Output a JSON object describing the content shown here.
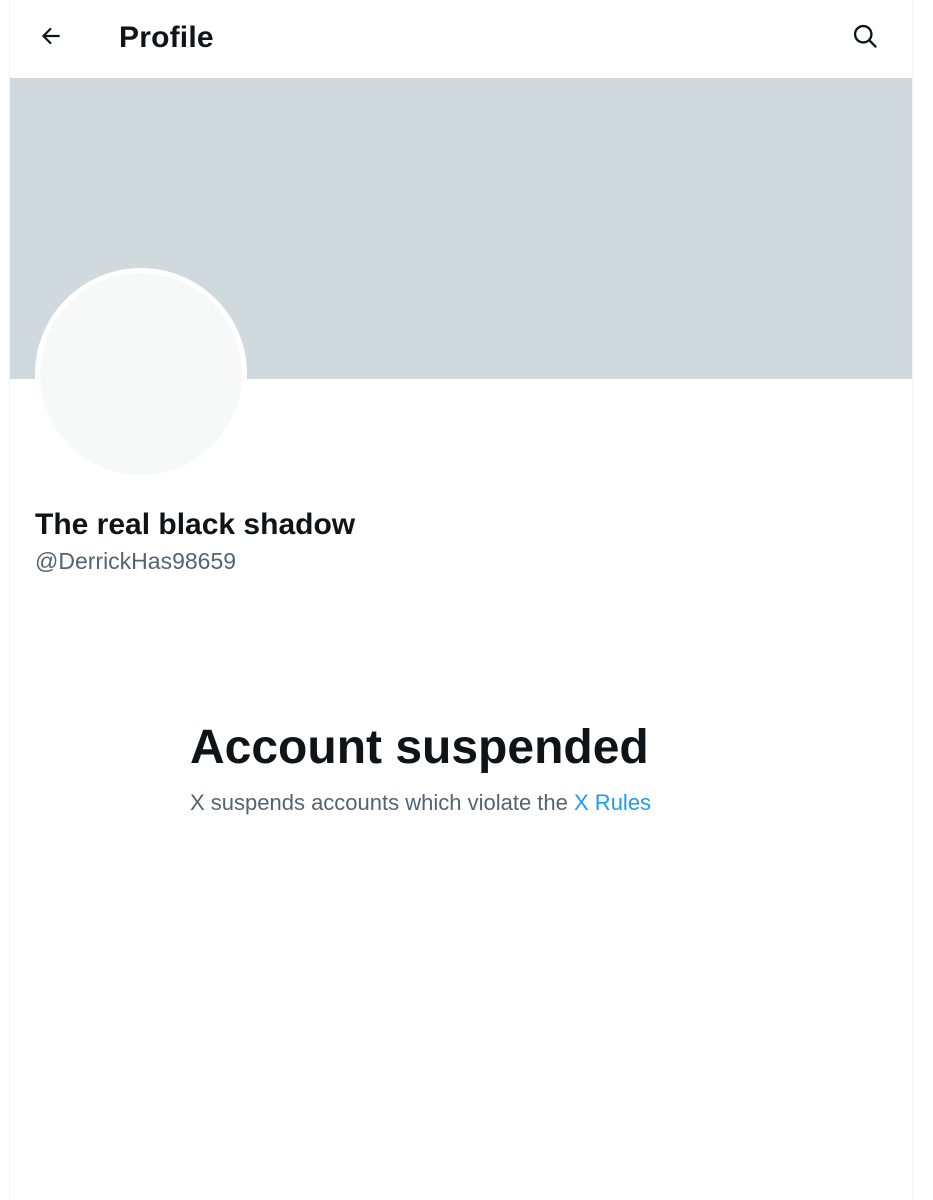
{
  "header": {
    "title": "Profile",
    "back_icon": "arrow-left-icon",
    "search_icon": "search-icon"
  },
  "profile": {
    "display_name": "The real black shadow",
    "handle": "@DerrickHas98659"
  },
  "suspended": {
    "title": "Account suspended",
    "message": "X suspends accounts which violate the",
    "link_text": "X Rules"
  },
  "colors": {
    "banner": "#cfd9de",
    "avatar": "#f7f9f9",
    "text_primary": "#0f1419",
    "text_secondary": "#536471",
    "link": "#1d9bf0"
  }
}
